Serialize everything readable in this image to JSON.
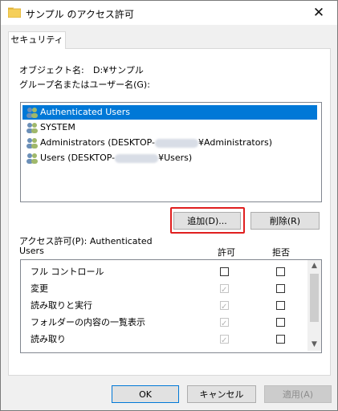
{
  "window": {
    "title": "サンプル のアクセス許可",
    "close_glyph": "✕"
  },
  "tab": "セキュリティ",
  "object_label": "オブジェクト名:",
  "object_value": "D:¥サンプル",
  "group_label": "グループ名またはユーザー名(G):",
  "users": [
    {
      "text": "Authenticated Users",
      "selected": true
    },
    {
      "text": "SYSTEM",
      "selected": false
    },
    {
      "text_a": "Administrators (DESKTOP-",
      "text_b": "¥Administrators)"
    },
    {
      "text_a": "Users (DESKTOP-",
      "text_b": "¥Users)"
    }
  ],
  "add_button": "追加(D)...",
  "remove_button": "削除(R)",
  "perm_label_line1": "アクセス許可(P): Authenticated",
  "perm_label_line2": "Users",
  "col_allow": "許可",
  "col_deny": "拒否",
  "permissions": [
    {
      "name": "フル コントロール",
      "allow": "unchecked",
      "deny": "unchecked"
    },
    {
      "name": "変更",
      "allow": "checked-disabled",
      "deny": "unchecked"
    },
    {
      "name": "読み取りと実行",
      "allow": "checked-disabled",
      "deny": "unchecked"
    },
    {
      "name": "フォルダーの内容の一覧表示",
      "allow": "checked-disabled",
      "deny": "unchecked"
    },
    {
      "name": "読み取り",
      "allow": "checked-disabled",
      "deny": "unchecked"
    }
  ],
  "ok_button": "OK",
  "cancel_button": "キャンセル",
  "apply_button": "適用(A)",
  "colors": {
    "selection": "#0078d7",
    "highlight_box": "#e01f1f"
  }
}
